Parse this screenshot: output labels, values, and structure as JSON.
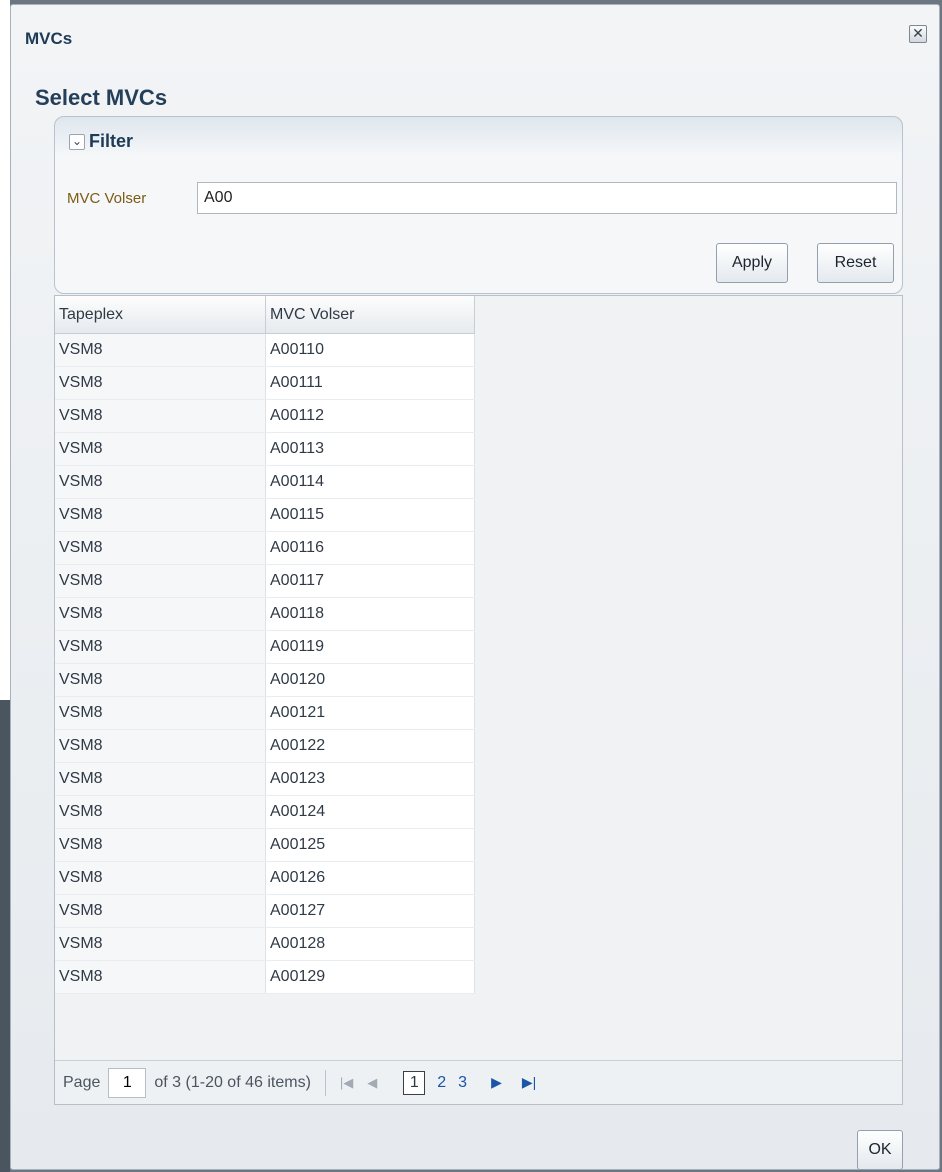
{
  "dialog": {
    "title": "MVCs",
    "close_icon": "close-icon"
  },
  "heading": "Select MVCs",
  "filter": {
    "label": "Filter",
    "toggle_icon": "chevron-down-icon",
    "field_label": "MVC Volser",
    "field_value": "A00",
    "apply_label": "Apply",
    "reset_label": "Reset"
  },
  "table": {
    "columns": [
      "Tapeplex",
      "MVC Volser"
    ],
    "rows": [
      [
        "VSM8",
        "A00110"
      ],
      [
        "VSM8",
        "A00111"
      ],
      [
        "VSM8",
        "A00112"
      ],
      [
        "VSM8",
        "A00113"
      ],
      [
        "VSM8",
        "A00114"
      ],
      [
        "VSM8",
        "A00115"
      ],
      [
        "VSM8",
        "A00116"
      ],
      [
        "VSM8",
        "A00117"
      ],
      [
        "VSM8",
        "A00118"
      ],
      [
        "VSM8",
        "A00119"
      ],
      [
        "VSM8",
        "A00120"
      ],
      [
        "VSM8",
        "A00121"
      ],
      [
        "VSM8",
        "A00122"
      ],
      [
        "VSM8",
        "A00123"
      ],
      [
        "VSM8",
        "A00124"
      ],
      [
        "VSM8",
        "A00125"
      ],
      [
        "VSM8",
        "A00126"
      ],
      [
        "VSM8",
        "A00127"
      ],
      [
        "VSM8",
        "A00128"
      ],
      [
        "VSM8",
        "A00129"
      ]
    ]
  },
  "pagination": {
    "page_label": "Page",
    "page_value": "1",
    "summary": "of 3 (1-20 of 46 items)",
    "pages": [
      "1",
      "2",
      "3"
    ],
    "current_page": "1",
    "first_icon": "first-page-icon",
    "prev_icon": "previous-page-icon",
    "next_icon": "next-page-icon",
    "last_icon": "last-page-icon"
  },
  "footer": {
    "ok_label": "OK"
  }
}
